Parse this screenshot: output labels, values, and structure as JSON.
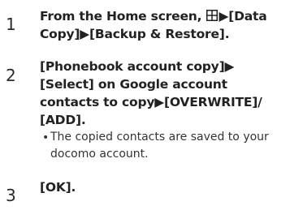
{
  "steps": [
    {
      "number": "1",
      "line1_prefix": "From the Home screen, ",
      "line1_suffix": "▶[Data",
      "line2": "Copy]▶[Backup & Restore].",
      "icon": "grid-icon"
    },
    {
      "number": "2",
      "line1": "[Phonebook account copy]▶",
      "line2": "[Select] on Google account",
      "line3": "contacts to copy▶[OVERWRITE]/",
      "line4": "[ADD].",
      "note_bullet": "•",
      "note_line1": "The copied contacts are saved to your",
      "note_line2": "docomo account."
    },
    {
      "number": "3",
      "line1": "[OK]."
    }
  ]
}
